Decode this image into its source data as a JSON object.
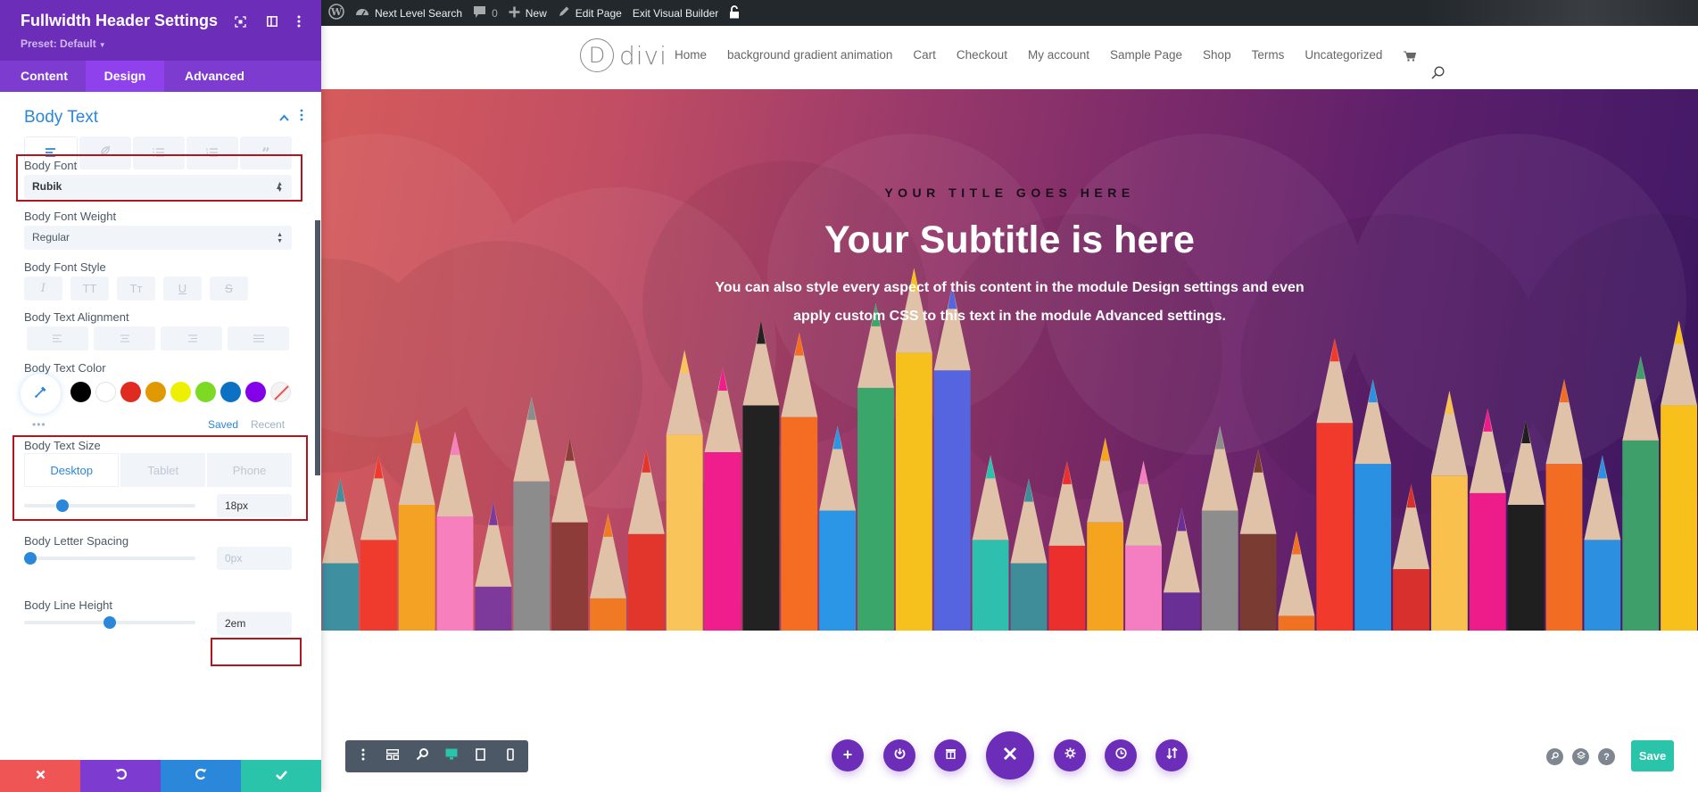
{
  "panel": {
    "title": "Fullwidth Header Settings",
    "preset": "Preset: Default",
    "tabs": [
      {
        "label": "Content",
        "active": false
      },
      {
        "label": "Design",
        "active": true
      },
      {
        "label": "Advanced",
        "active": false
      }
    ],
    "section": {
      "title": "Body Text",
      "subtabs": [
        "paragraph-icon",
        "link-icon",
        "unordered-list-icon",
        "ordered-list-icon",
        "quote-icon"
      ],
      "active_subtab": 0
    },
    "body_font": {
      "label": "Body Font",
      "value": "Rubik"
    },
    "body_font_weight": {
      "label": "Body Font Weight",
      "value": "Regular"
    },
    "body_font_style": {
      "label": "Body Font Style",
      "options": [
        "I",
        "TT",
        "Tт",
        "U",
        "S"
      ]
    },
    "body_text_alignment": {
      "label": "Body Text Alignment",
      "options": [
        "left",
        "center",
        "right",
        "justify"
      ]
    },
    "body_text_color": {
      "label": "Body Text Color",
      "swatches": [
        "#000000",
        "#ffffff",
        "#e02b20",
        "#e09900",
        "#edf000",
        "#7cda24",
        "#0c71c3",
        "#8300e9",
        "none"
      ],
      "saved_label": "Saved",
      "recent_label": "Recent",
      "more_label": "•••"
    },
    "body_text_size": {
      "label": "Body Text Size",
      "devices": [
        "Desktop",
        "Tablet",
        "Phone"
      ],
      "active_device": "Desktop",
      "value": "18px",
      "slider_fraction": 0.2
    },
    "body_letter_spacing": {
      "label": "Body Letter Spacing",
      "value": "0px",
      "slider_fraction": 0.0
    },
    "body_line_height": {
      "label": "Body Line Height",
      "value": "2em",
      "slider_fraction": 0.5
    },
    "footer": {
      "cancel": "close-icon",
      "undo": "undo-icon",
      "redo": "redo-icon",
      "save": "check-icon",
      "colors": [
        "#ef5555",
        "#7e3bd0",
        "#2b87da",
        "#29c4a9"
      ]
    }
  },
  "adminbar": {
    "items": [
      {
        "icon": "wordpress-icon",
        "label": ""
      },
      {
        "icon": "dashboard-icon",
        "label": "Next Level Search"
      },
      {
        "icon": "comment-icon",
        "label": "0"
      },
      {
        "icon": "plus-icon",
        "label": "New"
      },
      {
        "icon": "pencil-icon",
        "label": "Edit Page"
      },
      {
        "icon": "",
        "label": "Exit Visual Builder"
      },
      {
        "icon": "lock-icon",
        "label": ""
      }
    ]
  },
  "site": {
    "logo_letter": "D",
    "logo_word": "divi",
    "nav": [
      "Home",
      "background gradient animation",
      "Cart",
      "Checkout",
      "My account",
      "Sample Page",
      "Shop",
      "Terms",
      "Uncategorized"
    ]
  },
  "hero": {
    "title": "YOUR TITLE GOES HERE",
    "subtitle": "Your Subtitle is here",
    "body_line1": "You can also style every aspect of this content in the module Design settings and even",
    "body_line2": "apply custom CSS to this text in the module Advanced settings.",
    "pencil_colors": [
      "#3e8fa0",
      "#ef3a2e",
      "#f4a224",
      "#f77fbe",
      "#7d3a9a",
      "#8c8c8c",
      "#8e3c3a",
      "#f07a24",
      "#e2352b",
      "#f9c55a",
      "#f01d8c",
      "#222222",
      "#f56d22",
      "#2b95e6",
      "#3aa66a",
      "#f7c11d",
      "#5565e0",
      "#2fbfae",
      "#3f8d98",
      "#ea2f2c",
      "#f4a41f",
      "#f57dc2",
      "#6a2f95",
      "#8d8d8d",
      "#7a3b32",
      "#f07122",
      "#f23a2c",
      "#2a90e2",
      "#d8302c",
      "#f9c04d",
      "#ee1c8b",
      "#1f1f1f",
      "#f26c24",
      "#2d8fe0",
      "#3e9f6b",
      "#f8c01b"
    ]
  },
  "bottom": {
    "view_toolbar": [
      "more-icon",
      "wireframe-icon",
      "zoom-icon",
      "desktop-icon",
      "tablet-icon",
      "phone-icon"
    ],
    "action_buttons": [
      "add-icon",
      "power-icon",
      "trash-icon",
      "close-icon",
      "gear-icon",
      "history-icon",
      "sort-icon"
    ],
    "utility_buttons": [
      "search-icon",
      "layers-icon",
      "help-icon"
    ],
    "help_label": "?",
    "save_label": "Save"
  }
}
